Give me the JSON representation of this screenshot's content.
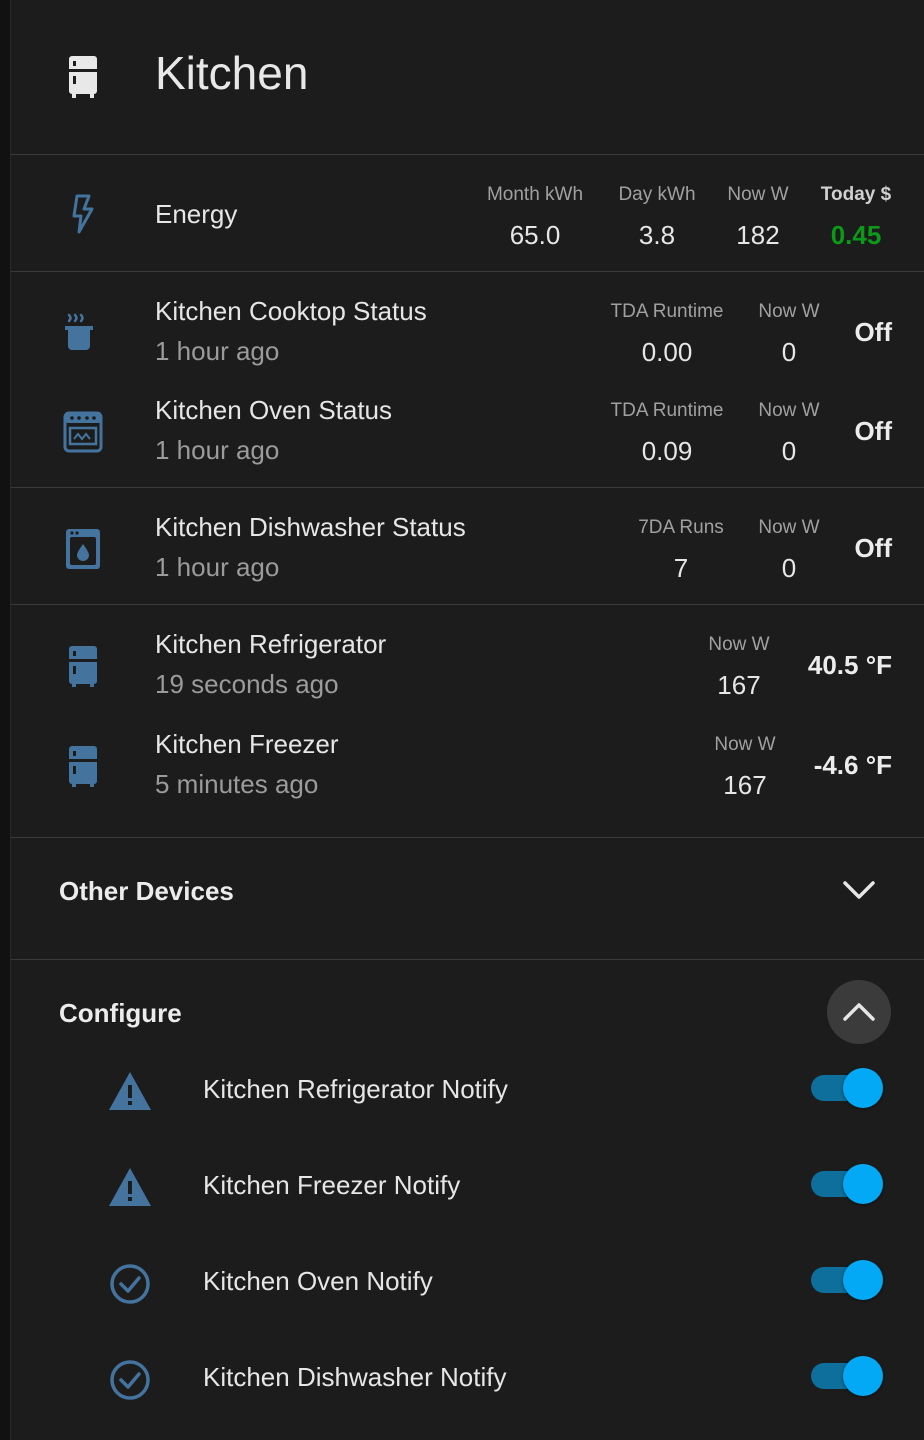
{
  "header": {
    "title": "Kitchen",
    "icon": "fridge-icon"
  },
  "energy": {
    "name": "Energy",
    "icon": "lightning-icon",
    "stats": [
      {
        "label": "Month kWh",
        "value": "65.0"
      },
      {
        "label": "Day kWh",
        "value": "3.8"
      },
      {
        "label": "Now W",
        "value": "182"
      },
      {
        "label": "Today $",
        "value": "0.45"
      }
    ],
    "cost_color": "#0a9a18"
  },
  "appliances": [
    {
      "name": "Kitchen Cooktop Status",
      "sub": "1 hour ago",
      "icon": "pot-steam-icon",
      "stat1_label": "TDA Runtime",
      "stat1_value": "0.00",
      "stat2_label": "Now W",
      "stat2_value": "0",
      "state": "Off"
    },
    {
      "name": "Kitchen Oven Status",
      "sub": "1 hour ago",
      "icon": "stove-icon",
      "stat1_label": "TDA Runtime",
      "stat1_value": "0.09",
      "stat2_label": "Now W",
      "stat2_value": "0",
      "state": "Off"
    },
    {
      "name": "Kitchen Dishwasher Status",
      "sub": "1 hour ago",
      "icon": "dishwasher-icon",
      "stat1_label": "7DA Runs",
      "stat1_value": "7",
      "stat2_label": "Now W",
      "stat2_value": "0",
      "state": "Off"
    }
  ],
  "fridges": [
    {
      "name": "Kitchen Refrigerator",
      "sub": "19 seconds ago",
      "icon": "fridge-icon",
      "stat_label": "Now W",
      "stat_value": "167",
      "state": "40.5 °F"
    },
    {
      "name": "Kitchen Freezer",
      "sub": "5 minutes ago",
      "icon": "fridge-icon",
      "stat_label": "Now W",
      "stat_value": "167",
      "state": "-4.6 °F"
    }
  ],
  "other_devices": {
    "title": "Other Devices",
    "expanded": false
  },
  "configure": {
    "title": "Configure",
    "expanded": true,
    "items": [
      {
        "label": "Kitchen Refrigerator Notify",
        "icon": "alert-icon",
        "on": true
      },
      {
        "label": "Kitchen Freezer Notify",
        "icon": "alert-icon",
        "on": true
      },
      {
        "label": "Kitchen Oven Notify",
        "icon": "check-circle-icon",
        "on": true
      },
      {
        "label": "Kitchen Dishwasher Notify",
        "icon": "check-circle-icon",
        "on": true
      }
    ]
  },
  "colors": {
    "icon_blue": "#44739e",
    "toggle_on": "#03a9f4",
    "card_bg": "#1c1c1c"
  }
}
